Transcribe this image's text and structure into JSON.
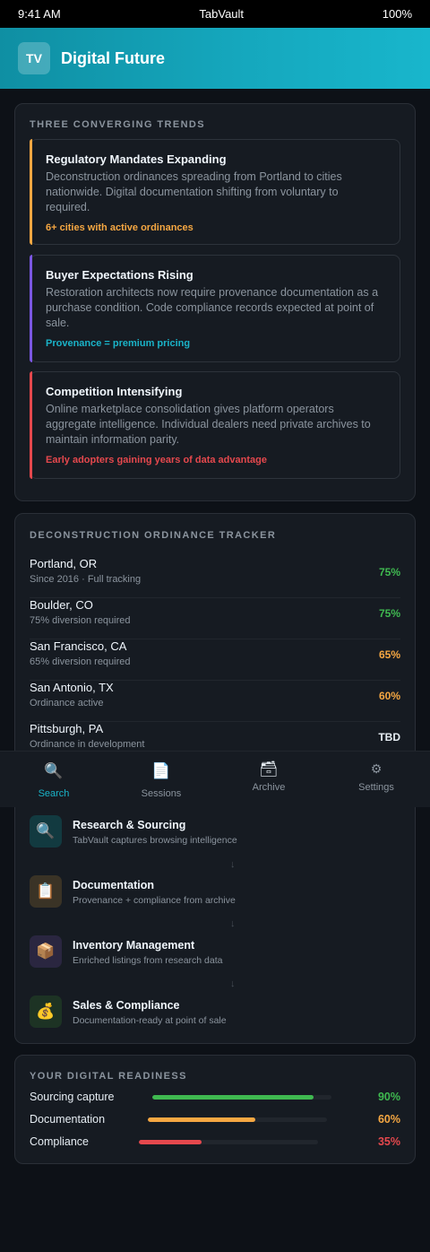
{
  "status_bar": {
    "time": "9:41 AM",
    "app": "TabVault",
    "battery": "100%"
  },
  "header": {
    "logo": "TV",
    "title": "Digital Future"
  },
  "trends": {
    "label": "THREE CONVERGING TRENDS",
    "items": [
      {
        "title": "Regulatory Mandates Expanding",
        "desc": "Deconstruction ordinances spreading from Portland to cities nationwide. Digital documentation shifting from voluntary to required.",
        "tag": "6+ cities with active ordinances",
        "accent": "#f5a742"
      },
      {
        "title": "Buyer Expectations Rising",
        "desc": "Restoration architects now require provenance documentation as a purchase condition. Code compliance records expected at point of sale.",
        "tag": "Provenance = premium pricing",
        "accent": "#7b57e3",
        "tag_color": "#1ab3c8"
      },
      {
        "title": "Competition Intensifying",
        "desc": "Online marketplace consolidation gives platform operators aggregate intelligence. Individual dealers need private archives to maintain information parity.",
        "tag": "Early adopters gaining years of data advantage",
        "accent": "#e5484d"
      }
    ]
  },
  "tracker": {
    "label": "DECONSTRUCTION ORDINANCE TRACKER",
    "rows": [
      {
        "city": "Portland, OR",
        "note": "Since 2016 · Full tracking",
        "pct": "75%",
        "color": "#3fb950"
      },
      {
        "city": "Boulder, CO",
        "note": "75% diversion required",
        "pct": "75%",
        "color": "#3fb950"
      },
      {
        "city": "San Francisco, CA",
        "note": "65% diversion required",
        "pct": "65%",
        "color": "#f5a742"
      },
      {
        "city": "San Antonio, TX",
        "note": "Ordinance active",
        "pct": "60%",
        "color": "#f5a742"
      },
      {
        "city": "Pittsburgh, PA",
        "note": "Ordinance in development",
        "pct": "TBD",
        "color": "#e6edf3"
      }
    ]
  },
  "tabs": [
    {
      "label": "Search",
      "icon": "search-icon",
      "glyph": "🔍",
      "active": true
    },
    {
      "label": "Sessions",
      "icon": "document-icon",
      "glyph": "📄",
      "active": false
    },
    {
      "label": "Archive",
      "icon": "archive-icon",
      "glyph": "🗃",
      "active": false
    },
    {
      "label": "Settings",
      "icon": "gear-icon",
      "glyph": "⚙",
      "active": false
    }
  ],
  "workflow": {
    "steps": [
      {
        "title": "Research & Sourcing",
        "sub": "TabVault captures browsing intelligence",
        "icon": "magnifier-icon",
        "glyph": "🔍",
        "bg": "#123a40"
      },
      {
        "title": "Documentation",
        "sub": "Provenance + compliance from archive",
        "icon": "clipboard-icon",
        "glyph": "📋",
        "bg": "#3a3326"
      },
      {
        "title": "Inventory Management",
        "sub": "Enriched listings from research data",
        "icon": "package-icon",
        "glyph": "📦",
        "bg": "#2a2640"
      },
      {
        "title": "Sales & Compliance",
        "sub": "Documentation-ready at point of sale",
        "icon": "money-bag-icon",
        "glyph": "💰",
        "bg": "#1d3324"
      }
    ],
    "arrow": "↓"
  },
  "readiness": {
    "label": "YOUR DIGITAL READINESS",
    "rows": [
      {
        "label": "Sourcing capture",
        "value": 0.9,
        "pct": "90%",
        "color": "#3fb950"
      },
      {
        "label": "Documentation",
        "value": 0.6,
        "pct": "60%",
        "color": "#f5a742"
      },
      {
        "label": "Compliance",
        "value": 0.35,
        "pct": "35%",
        "color": "#e5484d"
      }
    ]
  }
}
